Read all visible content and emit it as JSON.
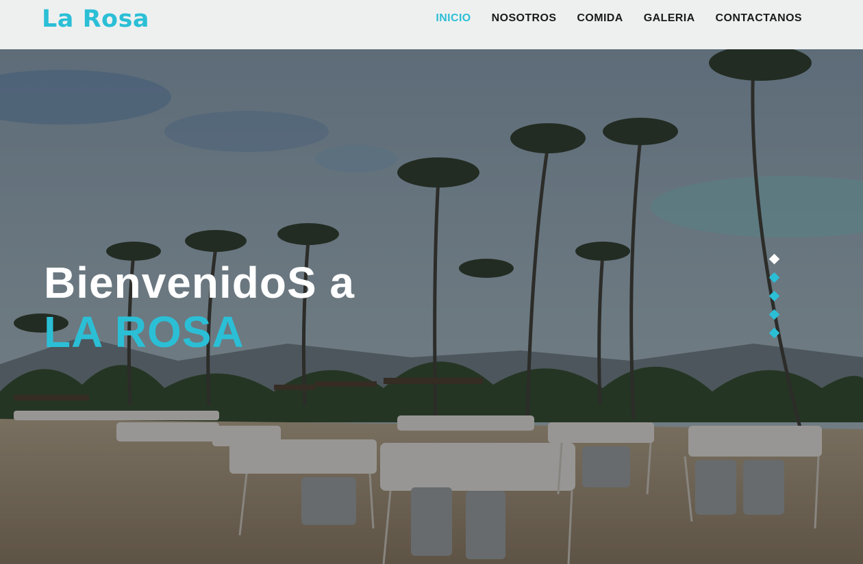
{
  "brand": {
    "logo": "La Rosa",
    "accent_color": "#2bbfd6"
  },
  "nav": {
    "items": [
      {
        "label": "INICIO",
        "active": true
      },
      {
        "label": "NOSOTROS",
        "active": false
      },
      {
        "label": "COMIDA",
        "active": false
      },
      {
        "label": "GALERIA",
        "active": false
      },
      {
        "label": "CONTACTANOS",
        "active": false
      }
    ]
  },
  "hero": {
    "line1": "BienvenidoS a",
    "line2": "LA ROSA",
    "background_image": "beach-with-palm-trees-and-canopy-chairs",
    "slides_count": 5,
    "active_slide": 1
  }
}
